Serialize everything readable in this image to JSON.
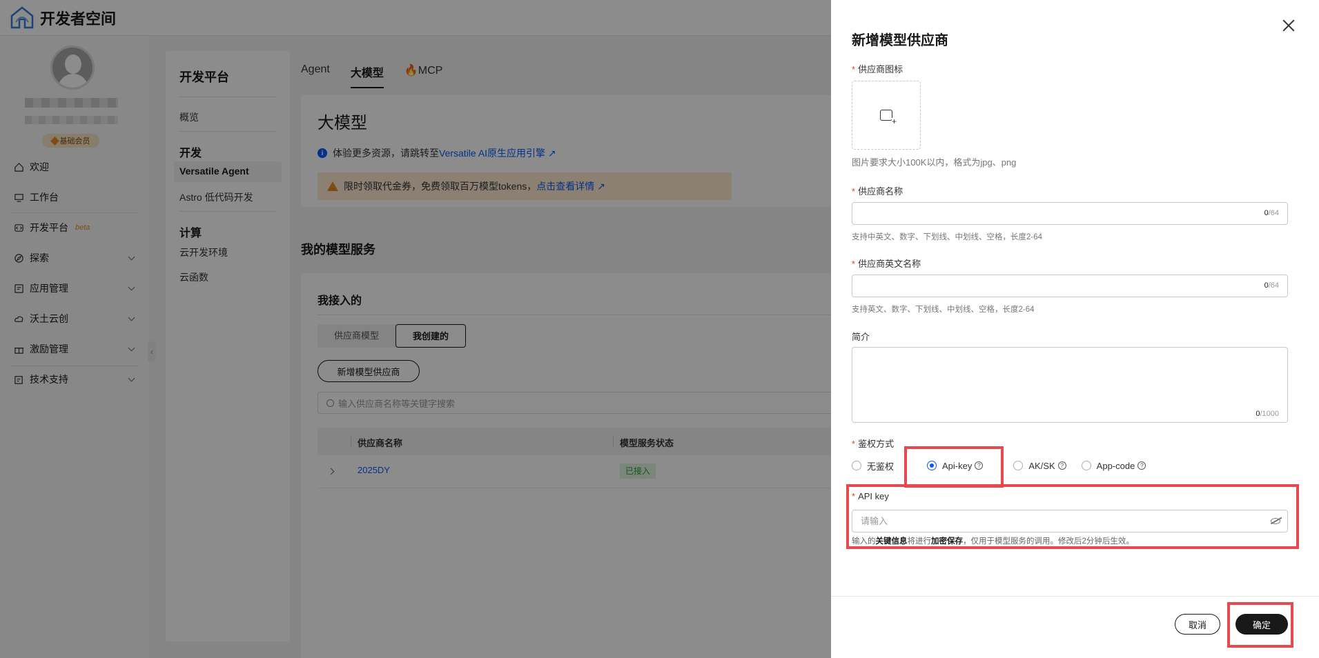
{
  "app": {
    "brand": "开发者空间"
  },
  "user": {
    "member_badge": "基础会员"
  },
  "left_nav": {
    "items": [
      {
        "label": "欢迎",
        "icon": "home-icon"
      },
      {
        "label": "工作台",
        "icon": "monitor-icon"
      },
      {
        "label": "开发平台",
        "icon": "code-icon",
        "badge": "beta"
      },
      {
        "label": "探索",
        "icon": "explore-icon"
      },
      {
        "label": "应用管理",
        "icon": "app-icon"
      },
      {
        "label": "沃土云创",
        "icon": "cloud-icon"
      },
      {
        "label": "激励管理",
        "icon": "gift-icon"
      },
      {
        "label": "技术支持",
        "icon": "support-icon"
      }
    ]
  },
  "sub_nav": {
    "title": "开发平台",
    "overview": "概览",
    "group_dev": "开发",
    "dev_items": [
      "Versatile Agent",
      "Astro 低代码开发"
    ],
    "group_compute": "计算",
    "compute_items": [
      "云开发环境",
      "云函数"
    ]
  },
  "main": {
    "tabs": [
      "Agent",
      "大模型",
      "MCP"
    ],
    "page_title": "大模型",
    "info_text": "体验更多资源，请跳转至 ",
    "info_link": "Versatile AI原生应用引擎",
    "warn_text": "限时领取代金券，免费领取百万模型tokens，",
    "warn_link": "点击查看详情",
    "section_title": "我的模型服务",
    "card_title": "我接入的",
    "segments": [
      "供应商模型",
      "我创建的"
    ],
    "add_button": "新增模型供应商",
    "search_placeholder": "输入供应商名称等关键字搜索",
    "columns": [
      "供应商名称",
      "模型服务状态"
    ],
    "rows": [
      {
        "name": "2025DY",
        "status": "已接入"
      }
    ]
  },
  "drawer": {
    "title": "新增模型供应商",
    "icon_label": "供应商图标",
    "icon_hint": "图片要求大小100K以内，格式为jpg、png",
    "name_label": "供应商名称",
    "name_counter_value": "0",
    "name_counter_max": "/64",
    "name_hint": "支持中英文、数字、下划线、中划线、空格，长度2-64",
    "en_name_label": "供应商英文名称",
    "en_counter_value": "0",
    "en_counter_max": "/64",
    "en_name_hint": "支持英文、数字、下划线、中划线、空格，长度2-64",
    "desc_label": "简介",
    "desc_counter_value": "0",
    "desc_counter_max": "/1000",
    "auth_label": "鉴权方式",
    "auth_options": [
      "无鉴权",
      "Api-key",
      "AK/SK",
      "App-code"
    ],
    "auth_selected": "Api-key",
    "apikey_label": "API key",
    "apikey_placeholder": "请输入",
    "note_pre": "输入的",
    "note_b1": "关键信息",
    "note_mid": "将进行",
    "note_b2": "加密保存",
    "note_post": "，仅用于模型服务的调用。修改后2分钟后生效。",
    "cancel": "取消",
    "ok": "确定"
  },
  "colors": {
    "accent": "#0a59f7",
    "highlight": "#e8484f",
    "required": "#e84026"
  }
}
